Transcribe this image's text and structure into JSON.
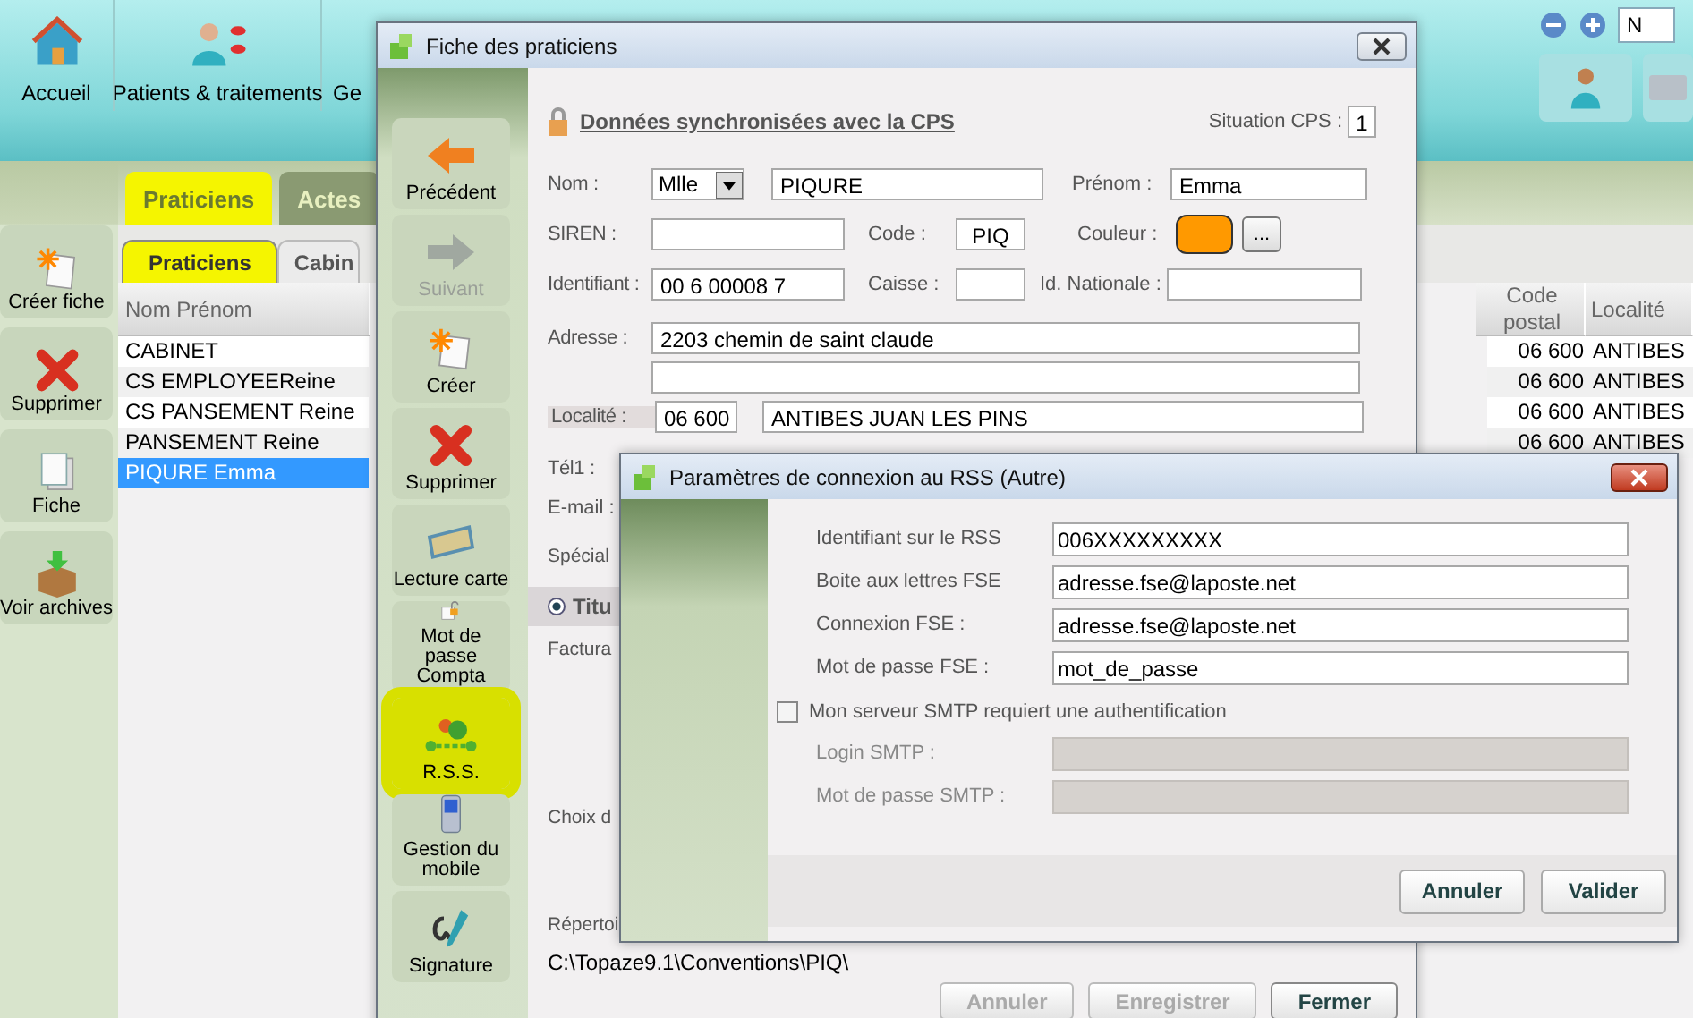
{
  "app_toolbar": {
    "buttons": [
      {
        "label": "Accueil",
        "kind": "house"
      },
      {
        "label": "Patients & traitements",
        "kind": "person"
      },
      {
        "label": "Ge",
        "kind": "none"
      }
    ],
    "search_value": "N"
  },
  "left_actions": [
    {
      "label": "Créer fiche",
      "kind": "new"
    },
    {
      "label": "Supprimer",
      "kind": "delete"
    },
    {
      "label": "Fiche",
      "kind": "pages"
    },
    {
      "label": "Voir archives",
      "kind": "box"
    }
  ],
  "tabs": [
    {
      "label": "Praticiens",
      "selected": true,
      "highlighted": true
    },
    {
      "label": "Actes",
      "selected": false,
      "highlighted": false
    }
  ],
  "subtabs": [
    {
      "label": "Praticiens",
      "selected": true,
      "highlighted": true
    },
    {
      "label": "Cabin",
      "selected": false,
      "highlighted": false
    }
  ],
  "table": {
    "columns": [
      "Nom Prénom",
      "Code postal",
      "Localité"
    ],
    "rows": [
      {
        "cells": [
          "CABINET",
          "06 600",
          "ANTIBES"
        ],
        "selected": false
      },
      {
        "cells": [
          "CS EMPLOYEEReine",
          "06 600",
          "ANTIBES"
        ],
        "selected": false
      },
      {
        "cells": [
          "CS PANSEMENT Reine",
          "06 600",
          "ANTIBES"
        ],
        "selected": false
      },
      {
        "cells": [
          "PANSEMENT Reine",
          "06 600",
          "ANTIBES"
        ],
        "selected": false
      },
      {
        "cells": [
          "PIQURE Emma"
        ],
        "selected": true
      }
    ]
  },
  "fiche": {
    "title": "Fiche des praticiens",
    "actions": [
      {
        "label": "Précédent",
        "kind": "prev",
        "disabled": false,
        "highlighted": false
      },
      {
        "label": "Suivant",
        "kind": "next",
        "disabled": true,
        "highlighted": false
      },
      {
        "label": "Créer",
        "kind": "new",
        "disabled": false,
        "highlighted": false
      },
      {
        "label": "Supprimer",
        "kind": "delete",
        "disabled": false,
        "highlighted": false
      },
      {
        "label": "Lecture carte",
        "kind": "card",
        "disabled": false,
        "highlighted": false
      },
      {
        "label": "Mot de passe Compta",
        "kind": "lock",
        "disabled": false,
        "highlighted": false
      },
      {
        "label": "R.S.S.",
        "kind": "rss",
        "disabled": false,
        "highlighted": true
      },
      {
        "label": "Gestion du mobile",
        "kind": "phone",
        "disabled": false,
        "highlighted": false
      },
      {
        "label": "Signature",
        "kind": "pen",
        "disabled": false,
        "highlighted": false
      }
    ],
    "sync_heading": "Données synchronisées avec la CPS",
    "situation": {
      "label": "Situation CPS :",
      "value": "1"
    },
    "nom": {
      "label": "Nom :",
      "civility": "Mlle",
      "value": "PIQURE"
    },
    "prenom": {
      "label": "Prénom :",
      "value": "Emma"
    },
    "siren": {
      "label": "SIREN :"
    },
    "code": {
      "label": "Code :",
      "value": "PIQ"
    },
    "couleur": {
      "label": "Couleur :",
      "color": "#ff9900",
      "button": "..."
    },
    "identifiant": {
      "label": "Identifiant :",
      "value": "00 6 00008 7"
    },
    "caisse": {
      "label": "Caisse :"
    },
    "id_nationale": {
      "label": "Id. Nationale :"
    },
    "adresse": {
      "label": "Adresse :",
      "value": "2203 chemin de saint claude"
    },
    "localite": {
      "label": "Localité :",
      "postal_code": "06 600",
      "city": "ANTIBES JUAN LES PINS"
    },
    "tel1": {
      "label": "Tél1 :"
    },
    "email": {
      "label": "E-mail :"
    },
    "specialite": {
      "label": "Spécial"
    },
    "titulaire": {
      "label": "Titu",
      "selected": true
    },
    "facturation": {
      "label": "Factura"
    },
    "choix": {
      "label": "Choix d"
    },
    "repertoire": {
      "label": "Répertoi",
      "path": "C:\\Topaze9.1\\Conventions\\PIQ\\"
    },
    "buttons": [
      {
        "label": "Annuler",
        "disabled": true
      },
      {
        "label": "Enregistrer",
        "disabled": true
      },
      {
        "label": "Fermer",
        "disabled": false
      }
    ]
  },
  "dialog": {
    "title": "Paramètres de connexion au RSS (Autre)",
    "rows": [
      {
        "kind": "field",
        "label": "Identifiant sur le RSS",
        "value": "006XXXXXXXXX",
        "disabled": false
      },
      {
        "kind": "field",
        "label": "Boite aux lettres FSE",
        "value": "adresse.fse@laposte.net",
        "disabled": false
      },
      {
        "kind": "field",
        "label": "Connexion FSE :",
        "value": "adresse.fse@laposte.net",
        "disabled": false
      },
      {
        "kind": "field",
        "label": "Mot de passe FSE :",
        "value": "mot_de_passe",
        "disabled": false
      },
      {
        "kind": "checkbox",
        "label": "Mon serveur SMTP requiert une authentification",
        "checked": false
      },
      {
        "kind": "field",
        "label": "Login SMTP :",
        "disabled": true
      },
      {
        "kind": "field",
        "label": "Mot de passe SMTP :",
        "disabled": true
      }
    ],
    "buttons": [
      "Annuler",
      "Valider"
    ]
  }
}
